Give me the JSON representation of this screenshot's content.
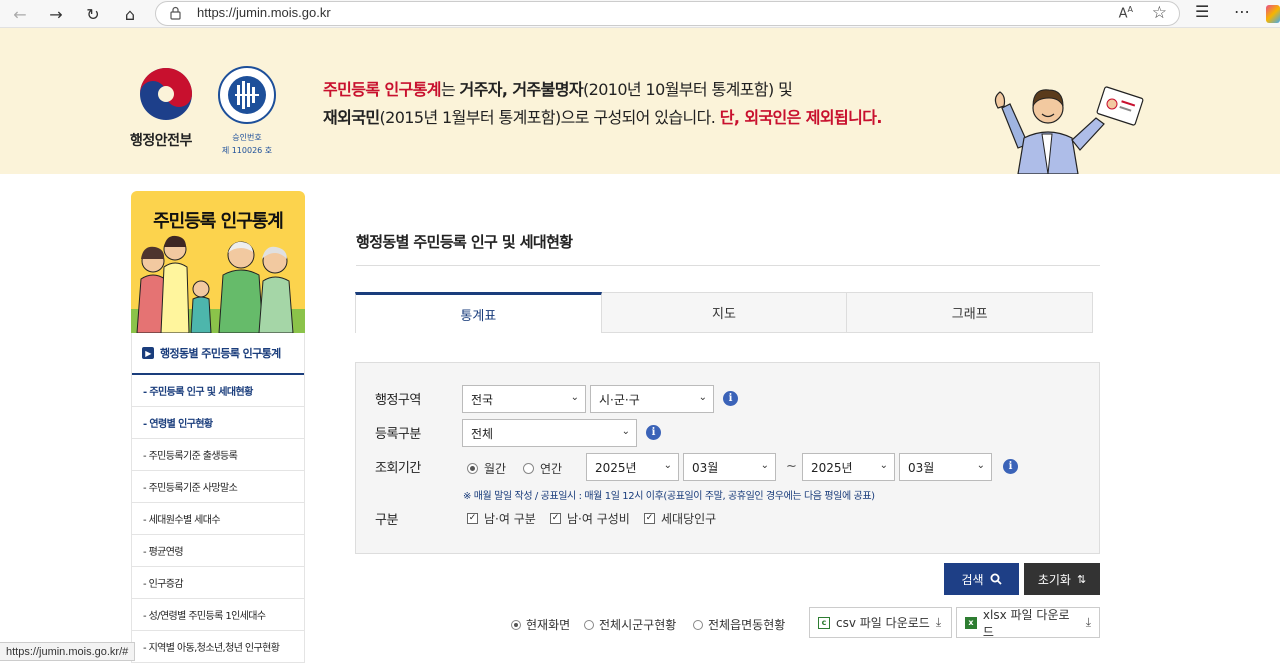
{
  "browser": {
    "url": "https://jumin.mois.go.kr",
    "read_aloud": "Aᴬ"
  },
  "banner": {
    "logo_name": "행정안전부",
    "stat_line1": "승인번호",
    "stat_line2": "제 110026 호",
    "line1_a": "주민등록 인구통계",
    "line1_b": "는 ",
    "line1_c": "거주자, 거주불명자",
    "line1_d": "(2010년 10월부터 통계포함) 및",
    "line2_a": "재외국민",
    "line2_b": "(2015년 1월부터 통계포함)으로 구성되어 있습니다. ",
    "line2_c": "단, 외국인은 제외됩니다."
  },
  "sidebar": {
    "title": "주민등록 인구통계",
    "main_item": "행정동별 주민등록 인구통계",
    "items": [
      "- 주민등록 인구 및 세대현황",
      "- 연령별 인구현황",
      "- 주민등록기준 출생등록",
      "- 주민등록기준 사망말소",
      "- 세대원수별 세대수",
      "- 평균연령",
      "- 인구증감",
      "- 성/연령별 주민등록 1인세대수",
      "- 지역별 아동,청소년,청년 인구현황"
    ]
  },
  "main": {
    "title": "행정동별 주민등록 인구 및 세대현황",
    "tabs": [
      "통계표",
      "지도",
      "그래프"
    ]
  },
  "form": {
    "region_label": "행정구역",
    "region_value": "전국",
    "subregion_value": "시·군·구",
    "regtype_label": "등록구분",
    "regtype_value": "전체",
    "period_label": "조회기간",
    "period_monthly": "월간",
    "period_yearly": "연간",
    "from_year": "2025년",
    "from_month": "03월",
    "tilde": "~",
    "to_year": "2025년",
    "to_month": "03월",
    "note": "※ 매월 말일 작성 / 공표일시 : 매월 1일 12시 이후(공표일이 주말, 공휴일인 경우에는 다음 평일에 공표)",
    "category_label": "구분",
    "cat1": "남·여 구분",
    "cat2": "남·여 구성비",
    "cat3": "세대당인구"
  },
  "actions": {
    "search": "검색",
    "reset": "초기화",
    "view_current": "현재화면",
    "view_sigungu": "전체시군구현황",
    "view_eupmyeondong": "전체읍면동현황",
    "csv_download": "csv 파일 다운로드",
    "xlsx_download": "xlsx 파일 다운로드"
  },
  "status_url": "https://jumin.mois.go.kr/#"
}
